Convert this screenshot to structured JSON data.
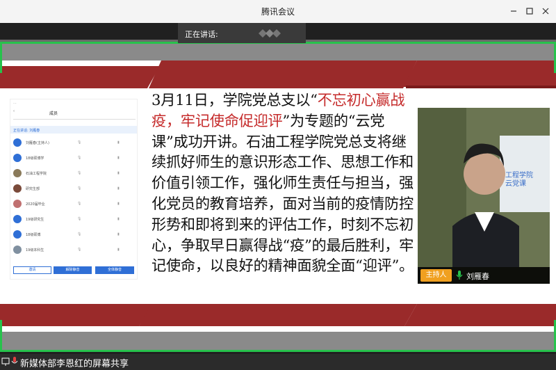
{
  "window": {
    "title": "腾讯会议"
  },
  "speaking": {
    "label": "正在讲话:"
  },
  "slide": {
    "text_before": "3月11日，学院党总支以“",
    "text_highlight": "不忘初心赢战疫，牢记使命促迎评",
    "text_after": "”为专题的“云党课”成功开讲。石油工程学院党总支将继续抓好师生的意识形态工作、思想工作和价值引领工作，强化师生责任与担当，强化党员的教育培养，面对当前的疫情防控形势和即将到来的评估工作，时刻不忘初心，争取早日赢得战“疫”的最后胜利，牢记使命，以良好的精神面貌全面“迎评”。",
    "video_bg_text": "工程学院\n云党课"
  },
  "phone": {
    "tab": "成员",
    "speaking_line": "正在讲话: 刘雁春",
    "members": [
      {
        "name": "刘雁春(主持人)",
        "color": "#2f6fd6"
      },
      {
        "name": "18级硕博学",
        "color": "#2f6fd6"
      },
      {
        "name": "石油工程学院",
        "color": "#8a7a5a"
      },
      {
        "name": "研究生部",
        "color": "#7a4a3a"
      },
      {
        "name": "2020届毕业",
        "color": "#c07070"
      },
      {
        "name": "19级研究生",
        "color": "#2f6fd6"
      },
      {
        "name": "18级硕博",
        "color": "#2f6fd6"
      },
      {
        "name": "19级本科生",
        "color": "#8090a0"
      }
    ],
    "buttons": [
      "邀请",
      "解除静音",
      "全体静音"
    ]
  },
  "video": {
    "host_badge": "主持人",
    "host_name": "刘雁春"
  },
  "bottombar": {
    "share_label": "新媒体部李恩红的屏幕共享"
  },
  "colors": {
    "accent_green": "#27c24c",
    "band_red": "#9a2a2a",
    "highlight_red": "#c52b2b",
    "host_orange": "#f0a020"
  }
}
